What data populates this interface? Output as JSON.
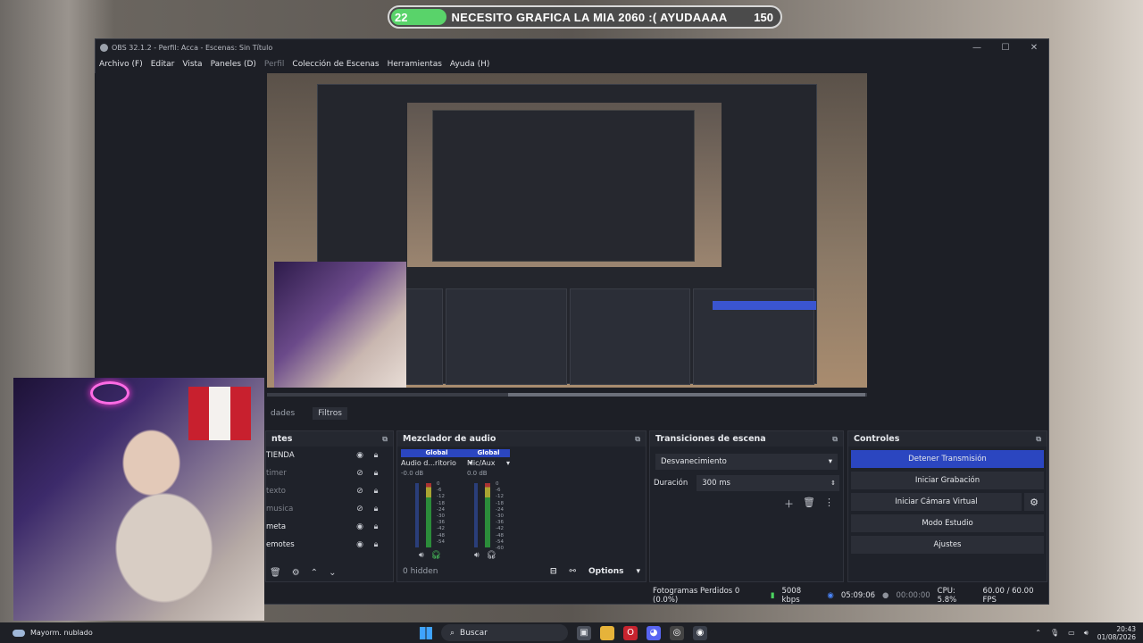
{
  "overlay_goal": {
    "current": "22",
    "text": "NECESITO GRAFICA LA MIA 2060 :( AYUDAAAA",
    "target": "150",
    "progress_fraction": 0.147
  },
  "window": {
    "title": "OBS 32.1.2 - Perfil: Acca - Escenas: Sin Título",
    "minimize": "—",
    "maximize": "☐",
    "close": "✕"
  },
  "menu": {
    "items": [
      "Archivo (F)",
      "Editar",
      "Vista",
      "Paneles (D)",
      "Perfil",
      "Colección de Escenas",
      "Herramientas",
      "Ayuda (H)"
    ]
  },
  "tabs": {
    "properties": "dades",
    "filters": "Filtros"
  },
  "sources": {
    "title": "ntes",
    "items": [
      {
        "label": "TIENDA",
        "visible": true
      },
      {
        "label": "timer",
        "visible": false
      },
      {
        "label": "texto",
        "visible": false
      },
      {
        "label": "musica",
        "visible": false
      },
      {
        "label": "meta",
        "visible": true
      },
      {
        "label": "emotes",
        "visible": true
      }
    ]
  },
  "mixer": {
    "title": "Mezclador de audio",
    "channels": [
      {
        "global": "Global",
        "name": "Audio d...ritorio",
        "db": "-0.0 dB"
      },
      {
        "global": "Global",
        "name": "Mic/Aux",
        "db": "0.0 dB"
      }
    ],
    "ticks": [
      "0",
      "-6",
      "-12",
      "-18",
      "-24",
      "-30",
      "-36",
      "-42",
      "-48",
      "-54",
      "-60"
    ],
    "hidden": "0 hidden",
    "options": "Options"
  },
  "transitions": {
    "title": "Transiciones de escena",
    "selected": "Desvanecimiento",
    "duration_label": "Duración",
    "duration_value": "300 ms"
  },
  "controls": {
    "title": "Controles",
    "stop_stream": "Detener Transmisión",
    "start_recording": "Iniciar Grabación",
    "start_virtual_cam": "Iniciar Cámara Virtual",
    "studio_mode": "Modo Estudio",
    "settings": "Ajustes"
  },
  "status": {
    "dropped": "Fotogramas Perdidos 0 (0.0%)",
    "bitrate": "5008 kbps",
    "stream_time": "05:09:06",
    "rec_time": "00:00:00",
    "cpu": "CPU: 5.8%",
    "fps": "60.00 / 60.00 FPS"
  },
  "taskbar": {
    "weather": "Mayorm. nublado",
    "search": "Buscar",
    "time": "20:43",
    "date": "01/08/2026"
  },
  "colors": {
    "accent": "#2b46c0",
    "goal_fill": "#59d36a",
    "status_green": "#4bd35f"
  }
}
